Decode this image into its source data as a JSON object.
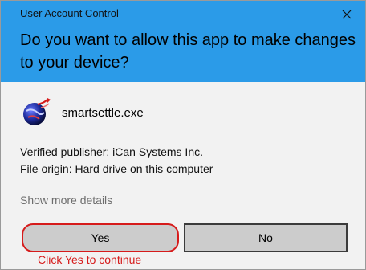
{
  "window": {
    "title": "User Account Control",
    "close_icon": "close-icon"
  },
  "prompt": {
    "question": "Do you want to allow this app to make changes to your device?"
  },
  "app": {
    "icon": "globe-app-icon",
    "name": "smartsettle.exe"
  },
  "details": {
    "publisher": "Verified publisher: iCan Systems Inc.",
    "origin": "File origin: Hard drive on this computer",
    "show_more": "Show more details"
  },
  "buttons": {
    "yes_label": "Yes",
    "no_label": "No"
  },
  "annotation": {
    "hint": "Click Yes to continue",
    "color": "#d61b1b"
  },
  "colors": {
    "header": "#2b9be8",
    "body": "#f2f2f2",
    "button": "#cccccc"
  }
}
